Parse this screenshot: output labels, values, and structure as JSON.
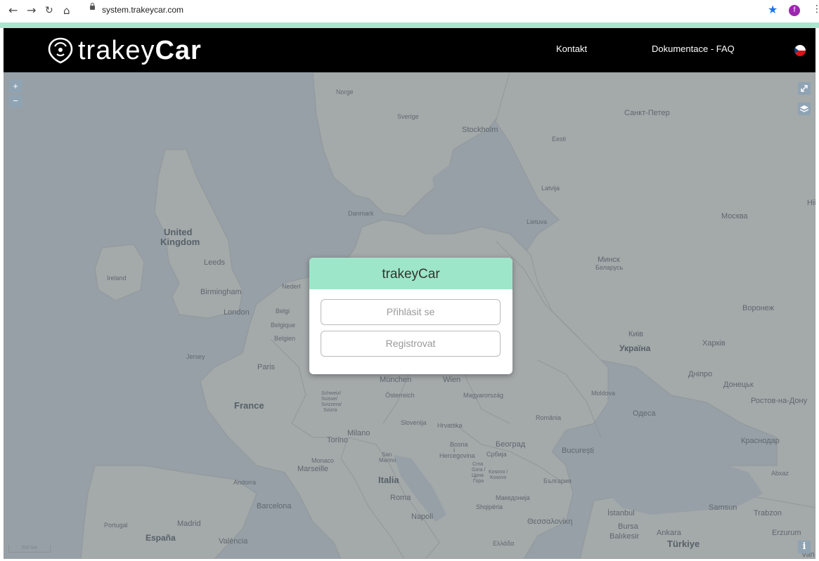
{
  "browser": {
    "url": "system.trakeycar.com",
    "profile_initial": "f",
    "nav_icons": [
      "back-arrow-icon",
      "forward-arrow-icon",
      "reload-icon",
      "home-icon"
    ]
  },
  "header": {
    "logo_light": "trakey",
    "logo_bold": "Car",
    "links": [
      "Kontakt",
      "Dokumentace - FAQ"
    ],
    "language": "cs"
  },
  "map": {
    "zoom_in": "+",
    "zoom_out": "−",
    "scale": "200 km",
    "info": "i",
    "labels": [
      {
        "text": "Norge",
        "size": "small"
      },
      {
        "text": "Sverige",
        "size": "small"
      },
      {
        "text": "Stockholm",
        "size": "mid"
      },
      {
        "text": "Eesti",
        "size": "small"
      },
      {
        "text": "Санкт-Петер",
        "size": "mid"
      },
      {
        "text": "Latvija",
        "size": "small"
      },
      {
        "text": "Danmark",
        "size": "small"
      },
      {
        "text": "Lietuva",
        "size": "small"
      },
      {
        "text": "Москва",
        "size": "mid"
      },
      {
        "text": "United",
        "size": "big"
      },
      {
        "text": "Kingdom",
        "size": "big"
      },
      {
        "text": "Leeds",
        "size": "mid"
      },
      {
        "text": "Ireland",
        "size": "small"
      },
      {
        "text": "Birmingham",
        "size": "mid"
      },
      {
        "text": "Nederl",
        "size": "small"
      },
      {
        "text": "London",
        "size": "mid"
      },
      {
        "text": "Belgi",
        "size": "small"
      },
      {
        "text": "Belgique",
        "size": "small"
      },
      {
        "text": "Belgien",
        "size": "small"
      },
      {
        "text": "Jersey",
        "size": "small"
      },
      {
        "text": "Paris",
        "size": "mid"
      },
      {
        "text": "Минск",
        "size": "mid"
      },
      {
        "text": "Беларусь",
        "size": "small"
      },
      {
        "text": "Воронеж",
        "size": "mid"
      },
      {
        "text": "Киів",
        "size": "mid"
      },
      {
        "text": "Україна",
        "size": "bigish"
      },
      {
        "text": "Харків",
        "size": "mid"
      },
      {
        "text": "Дніпро",
        "size": "mid"
      },
      {
        "text": "Донецьк",
        "size": "mid"
      },
      {
        "text": "Ростов-на-Дону",
        "size": "mid"
      },
      {
        "text": "France",
        "size": "big"
      },
      {
        "text": "Schweiz/",
        "size": "small"
      },
      {
        "text": "Suisse/",
        "size": "small"
      },
      {
        "text": "Svizzera/",
        "size": "small"
      },
      {
        "text": "Svizra",
        "size": "small"
      },
      {
        "text": "München",
        "size": "mid"
      },
      {
        "text": "Wien",
        "size": "mid"
      },
      {
        "text": "Österreich",
        "size": "small"
      },
      {
        "text": "Magyarország",
        "size": "small"
      },
      {
        "text": "Moldova",
        "size": "small"
      },
      {
        "text": "Одеса",
        "size": "mid"
      },
      {
        "text": "România",
        "size": "small"
      },
      {
        "text": "Slovenija",
        "size": "small"
      },
      {
        "text": "Hrvatska",
        "size": "small"
      },
      {
        "text": "Milano",
        "size": "mid"
      },
      {
        "text": "Torino",
        "size": "mid"
      },
      {
        "text": "Bosna",
        "size": "small"
      },
      {
        "text": "i",
        "size": "small"
      },
      {
        "text": "Hercegovina",
        "size": "small"
      },
      {
        "text": "Београд",
        "size": "mid"
      },
      {
        "text": "Србија",
        "size": "small"
      },
      {
        "text": "București",
        "size": "mid"
      },
      {
        "text": "Краснодар",
        "size": "mid"
      },
      {
        "text": "Monaco",
        "size": "small"
      },
      {
        "text": "San",
        "size": "small"
      },
      {
        "text": "Marino",
        "size": "small"
      },
      {
        "text": "Crna",
        "size": "small"
      },
      {
        "text": "Gora /",
        "size": "small"
      },
      {
        "text": "Црна",
        "size": "small"
      },
      {
        "text": "Гора",
        "size": "small"
      },
      {
        "text": "Kosovo /",
        "size": "small"
      },
      {
        "text": "Kosovo",
        "size": "small"
      },
      {
        "text": "Marseille",
        "size": "mid"
      },
      {
        "text": "Andorra",
        "size": "small"
      },
      {
        "text": "Italia",
        "size": "big"
      },
      {
        "text": "България",
        "size": "small"
      },
      {
        "text": "Roma",
        "size": "mid"
      },
      {
        "text": "Македонија",
        "size": "small"
      },
      {
        "text": "Shqipëria",
        "size": "small"
      },
      {
        "text": "Barcelona",
        "size": "mid"
      },
      {
        "text": "Napoli",
        "size": "mid"
      },
      {
        "text": "Θεσσαλονίκη",
        "size": "mid"
      },
      {
        "text": "İstanbul",
        "size": "mid"
      },
      {
        "text": "Samsun",
        "size": "mid"
      },
      {
        "text": "Trabzon",
        "size": "mid"
      },
      {
        "text": "Portugal",
        "size": "small"
      },
      {
        "text": "Madrid",
        "size": "mid"
      },
      {
        "text": "Bursa",
        "size": "mid"
      },
      {
        "text": "Ankara",
        "size": "mid"
      },
      {
        "text": "Erzurum",
        "size": "mid"
      },
      {
        "text": "España",
        "size": "bigish"
      },
      {
        "text": "València",
        "size": "mid"
      },
      {
        "text": "Ελλάδα",
        "size": "small"
      },
      {
        "text": "Balıkesir",
        "size": "mid"
      },
      {
        "text": "Türkiye",
        "size": "big"
      },
      {
        "text": "Abxaz",
        "size": "small"
      },
      {
        "text": "Hii",
        "size": "mid"
      },
      {
        "text": "Van",
        "size": "mid"
      }
    ]
  },
  "dialog": {
    "title": "trakeyCar",
    "login_label": "Přihlásit se",
    "register_label": "Registrovat"
  },
  "colors": {
    "accent": "#a8e6cf",
    "dialog_header": "#9ee6c9",
    "header_bg": "#000000"
  }
}
